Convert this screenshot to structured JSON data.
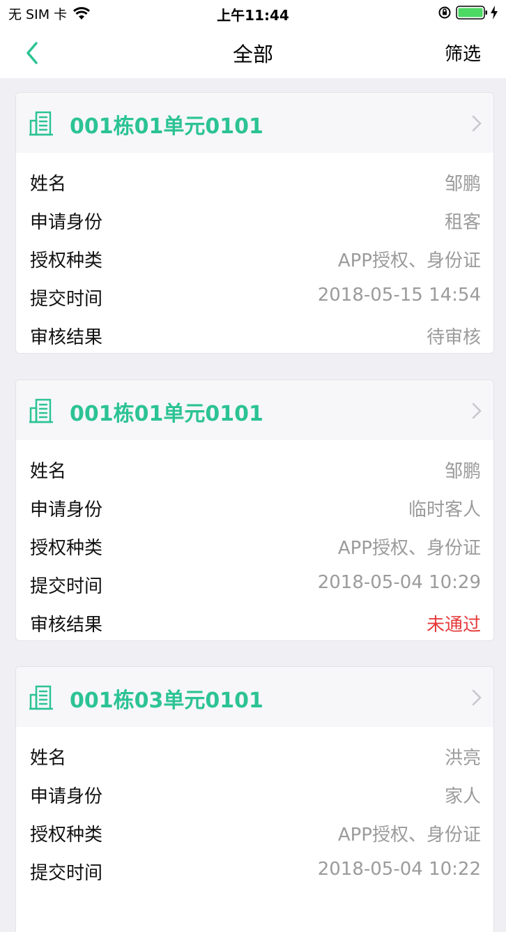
{
  "status_bar": {
    "carrier": "无 SIM 卡",
    "time": "上午11:44",
    "icons": [
      "wifi-icon",
      "rotation-lock-icon",
      "battery-icon",
      "charging-icon"
    ]
  },
  "nav": {
    "title": "全部",
    "filter_label": "筛选",
    "back_icon": "chevron-left-icon"
  },
  "colors": {
    "accent": "#2cc393",
    "fail": "#e63b3b",
    "value_gray": "#9b9b9b",
    "background": "#efeff4"
  },
  "records": [
    {
      "title": "001栋01单元0101",
      "rows": [
        {
          "label": "姓名",
          "value": "邹鹏"
        },
        {
          "label": "申请身份",
          "value": "租客"
        },
        {
          "label": "授权种类",
          "value": "APP授权、身份证"
        },
        {
          "label": "提交时间",
          "value": "2018-05-15 14:54"
        },
        {
          "label": "审核结果",
          "value": "待审核"
        }
      ]
    },
    {
      "title": "001栋01单元0101",
      "rows": [
        {
          "label": "姓名",
          "value": "邹鹏"
        },
        {
          "label": "申请身份",
          "value": "临时客人"
        },
        {
          "label": "授权种类",
          "value": "APP授权、身份证"
        },
        {
          "label": "提交时间",
          "value": "2018-05-04 10:29"
        },
        {
          "label": "审核结果",
          "value": "未通过"
        }
      ]
    },
    {
      "title": "001栋03单元0101",
      "rows": [
        {
          "label": "姓名",
          "value": "洪亮"
        },
        {
          "label": "申请身份",
          "value": "家人"
        },
        {
          "label": "授权种类",
          "value": "APP授权、身份证"
        },
        {
          "label": "提交时间",
          "value": "2018-05-04 10:22"
        }
      ]
    }
  ]
}
